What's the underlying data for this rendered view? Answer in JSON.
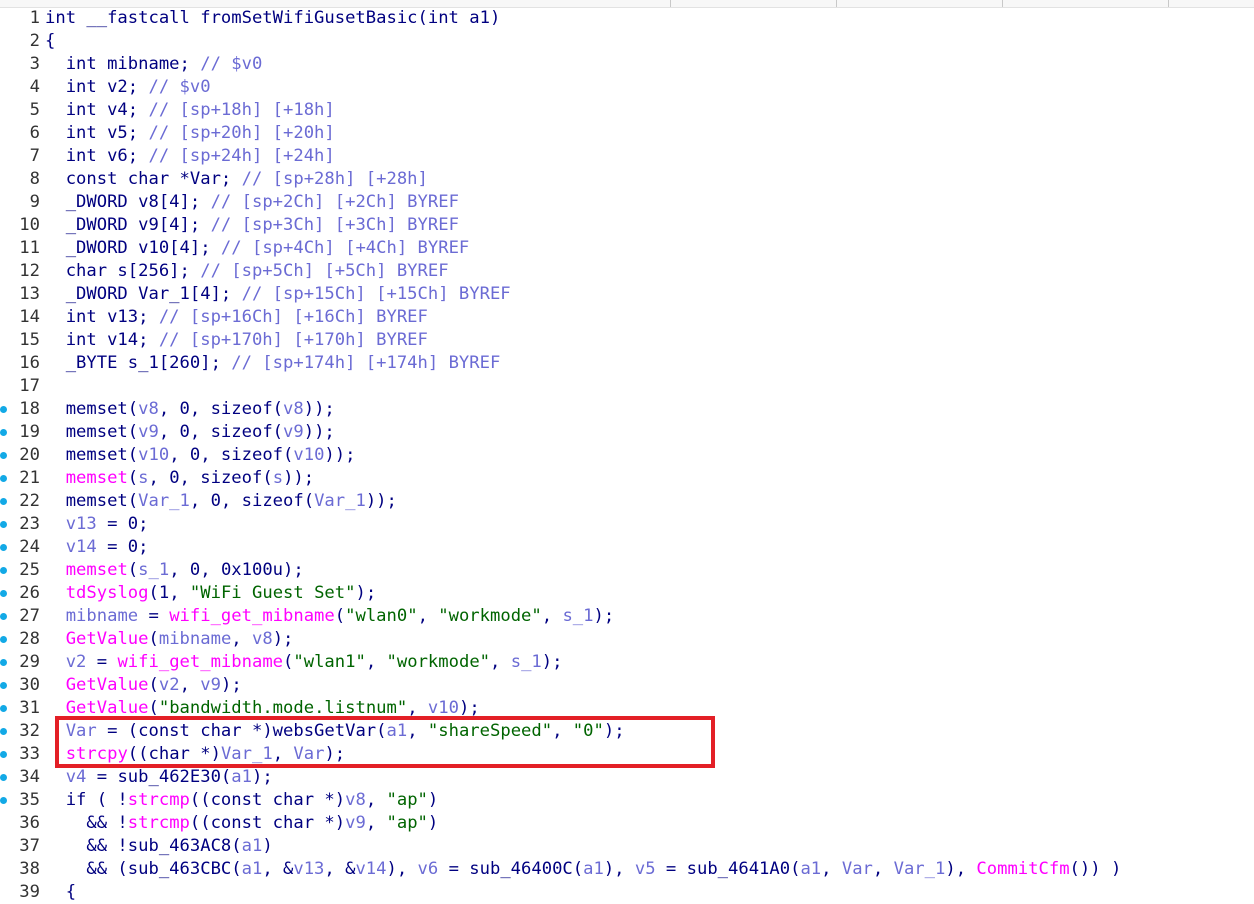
{
  "editor": {
    "function_signature": "int __fastcall fromSetWifiGusetBasic(int a1)",
    "lines": [
      {
        "n": "1",
        "dot": false,
        "tokens": [
          {
            "t": "int __fastcall fromSetWifiGusetBasic(int a1)",
            "c": "plain"
          }
        ]
      },
      {
        "n": "2",
        "dot": false,
        "tokens": [
          {
            "t": "{",
            "c": "plain"
          }
        ]
      },
      {
        "n": "3",
        "dot": false,
        "tokens": [
          {
            "t": "  int mibname; ",
            "c": "plain"
          },
          {
            "t": "// $v0",
            "c": "comment"
          }
        ]
      },
      {
        "n": "4",
        "dot": false,
        "tokens": [
          {
            "t": "  int v2; ",
            "c": "plain"
          },
          {
            "t": "// $v0",
            "c": "comment"
          }
        ]
      },
      {
        "n": "5",
        "dot": false,
        "tokens": [
          {
            "t": "  int v4; ",
            "c": "plain"
          },
          {
            "t": "// [sp+18h] [+18h]",
            "c": "comment"
          }
        ]
      },
      {
        "n": "6",
        "dot": false,
        "tokens": [
          {
            "t": "  int v5; ",
            "c": "plain"
          },
          {
            "t": "// [sp+20h] [+20h]",
            "c": "comment"
          }
        ]
      },
      {
        "n": "7",
        "dot": false,
        "tokens": [
          {
            "t": "  int v6; ",
            "c": "plain"
          },
          {
            "t": "// [sp+24h] [+24h]",
            "c": "comment"
          }
        ]
      },
      {
        "n": "8",
        "dot": false,
        "tokens": [
          {
            "t": "  const char *Var; ",
            "c": "plain"
          },
          {
            "t": "// [sp+28h] [+28h]",
            "c": "comment"
          }
        ]
      },
      {
        "n": "9",
        "dot": false,
        "tokens": [
          {
            "t": "  _DWORD v8[4]; ",
            "c": "plain"
          },
          {
            "t": "// [sp+2Ch] [+2Ch] BYREF",
            "c": "comment"
          }
        ]
      },
      {
        "n": "10",
        "dot": false,
        "tokens": [
          {
            "t": "  _DWORD v9[4]; ",
            "c": "plain"
          },
          {
            "t": "// [sp+3Ch] [+3Ch] BYREF",
            "c": "comment"
          }
        ]
      },
      {
        "n": "11",
        "dot": false,
        "tokens": [
          {
            "t": "  _DWORD v10[4]; ",
            "c": "plain"
          },
          {
            "t": "// [sp+4Ch] [+4Ch] BYREF",
            "c": "comment"
          }
        ]
      },
      {
        "n": "12",
        "dot": false,
        "tokens": [
          {
            "t": "  char s[256]; ",
            "c": "plain"
          },
          {
            "t": "// [sp+5Ch] [+5Ch] BYREF",
            "c": "comment"
          }
        ]
      },
      {
        "n": "13",
        "dot": false,
        "tokens": [
          {
            "t": "  _DWORD Var_1[4]; ",
            "c": "plain"
          },
          {
            "t": "// [sp+15Ch] [+15Ch] BYREF",
            "c": "comment"
          }
        ]
      },
      {
        "n": "14",
        "dot": false,
        "tokens": [
          {
            "t": "  int v13; ",
            "c": "plain"
          },
          {
            "t": "// [sp+16Ch] [+16Ch] BYREF",
            "c": "comment"
          }
        ]
      },
      {
        "n": "15",
        "dot": false,
        "tokens": [
          {
            "t": "  int v14; ",
            "c": "plain"
          },
          {
            "t": "// [sp+170h] [+170h] BYREF",
            "c": "comment"
          }
        ]
      },
      {
        "n": "16",
        "dot": false,
        "tokens": [
          {
            "t": "  _BYTE s_1[260]; ",
            "c": "plain"
          },
          {
            "t": "// [sp+174h] [+174h] BYREF",
            "c": "comment"
          }
        ]
      },
      {
        "n": "17",
        "dot": false,
        "tokens": [
          {
            "t": "",
            "c": "plain"
          }
        ]
      },
      {
        "n": "18",
        "dot": true,
        "tokens": [
          {
            "t": "  memset(",
            "c": "plain"
          },
          {
            "t": "v8",
            "c": "var"
          },
          {
            "t": ", 0, sizeof(",
            "c": "plain"
          },
          {
            "t": "v8",
            "c": "var"
          },
          {
            "t": "));",
            "c": "plain"
          }
        ]
      },
      {
        "n": "19",
        "dot": true,
        "tokens": [
          {
            "t": "  memset(",
            "c": "plain"
          },
          {
            "t": "v9",
            "c": "var"
          },
          {
            "t": ", 0, sizeof(",
            "c": "plain"
          },
          {
            "t": "v9",
            "c": "var"
          },
          {
            "t": "));",
            "c": "plain"
          }
        ]
      },
      {
        "n": "20",
        "dot": true,
        "tokens": [
          {
            "t": "  memset(",
            "c": "plain"
          },
          {
            "t": "v10",
            "c": "var"
          },
          {
            "t": ", 0, sizeof(",
            "c": "plain"
          },
          {
            "t": "v10",
            "c": "var"
          },
          {
            "t": "));",
            "c": "plain"
          }
        ]
      },
      {
        "n": "21",
        "dot": true,
        "tokens": [
          {
            "t": "  ",
            "c": "plain"
          },
          {
            "t": "memset",
            "c": "func"
          },
          {
            "t": "(",
            "c": "plain"
          },
          {
            "t": "s",
            "c": "var"
          },
          {
            "t": ", 0, sizeof(",
            "c": "plain"
          },
          {
            "t": "s",
            "c": "var"
          },
          {
            "t": "));",
            "c": "plain"
          }
        ]
      },
      {
        "n": "22",
        "dot": true,
        "tokens": [
          {
            "t": "  memset(",
            "c": "plain"
          },
          {
            "t": "Var_1",
            "c": "var"
          },
          {
            "t": ", 0, sizeof(",
            "c": "plain"
          },
          {
            "t": "Var_1",
            "c": "var"
          },
          {
            "t": "));",
            "c": "plain"
          }
        ]
      },
      {
        "n": "23",
        "dot": true,
        "tokens": [
          {
            "t": "  ",
            "c": "plain"
          },
          {
            "t": "v13",
            "c": "var"
          },
          {
            "t": " = 0;",
            "c": "plain"
          }
        ]
      },
      {
        "n": "24",
        "dot": true,
        "tokens": [
          {
            "t": "  ",
            "c": "plain"
          },
          {
            "t": "v14",
            "c": "var"
          },
          {
            "t": " = 0;",
            "c": "plain"
          }
        ]
      },
      {
        "n": "25",
        "dot": true,
        "tokens": [
          {
            "t": "  ",
            "c": "plain"
          },
          {
            "t": "memset",
            "c": "func"
          },
          {
            "t": "(",
            "c": "plain"
          },
          {
            "t": "s_1",
            "c": "var"
          },
          {
            "t": ", 0, 0x100u);",
            "c": "plain"
          }
        ]
      },
      {
        "n": "26",
        "dot": true,
        "tokens": [
          {
            "t": "  ",
            "c": "plain"
          },
          {
            "t": "tdSyslog",
            "c": "func"
          },
          {
            "t": "(1, ",
            "c": "plain"
          },
          {
            "t": "\"WiFi Guest Set\"",
            "c": "string"
          },
          {
            "t": ");",
            "c": "plain"
          }
        ]
      },
      {
        "n": "27",
        "dot": true,
        "tokens": [
          {
            "t": "  ",
            "c": "plain"
          },
          {
            "t": "mibname",
            "c": "var"
          },
          {
            "t": " = ",
            "c": "plain"
          },
          {
            "t": "wifi_get_mibname",
            "c": "func"
          },
          {
            "t": "(",
            "c": "plain"
          },
          {
            "t": "\"wlan0\"",
            "c": "string"
          },
          {
            "t": ", ",
            "c": "plain"
          },
          {
            "t": "\"workmode\"",
            "c": "string"
          },
          {
            "t": ", ",
            "c": "plain"
          },
          {
            "t": "s_1",
            "c": "var"
          },
          {
            "t": ");",
            "c": "plain"
          }
        ]
      },
      {
        "n": "28",
        "dot": true,
        "tokens": [
          {
            "t": "  ",
            "c": "plain"
          },
          {
            "t": "GetValue",
            "c": "func"
          },
          {
            "t": "(",
            "c": "plain"
          },
          {
            "t": "mibname",
            "c": "var"
          },
          {
            "t": ", ",
            "c": "plain"
          },
          {
            "t": "v8",
            "c": "var"
          },
          {
            "t": ");",
            "c": "plain"
          }
        ]
      },
      {
        "n": "29",
        "dot": true,
        "tokens": [
          {
            "t": "  ",
            "c": "plain"
          },
          {
            "t": "v2",
            "c": "var"
          },
          {
            "t": " = ",
            "c": "plain"
          },
          {
            "t": "wifi_get_mibname",
            "c": "func"
          },
          {
            "t": "(",
            "c": "plain"
          },
          {
            "t": "\"wlan1\"",
            "c": "string"
          },
          {
            "t": ", ",
            "c": "plain"
          },
          {
            "t": "\"workmode\"",
            "c": "string"
          },
          {
            "t": ", ",
            "c": "plain"
          },
          {
            "t": "s_1",
            "c": "var"
          },
          {
            "t": ");",
            "c": "plain"
          }
        ]
      },
      {
        "n": "30",
        "dot": true,
        "tokens": [
          {
            "t": "  ",
            "c": "plain"
          },
          {
            "t": "GetValue",
            "c": "func"
          },
          {
            "t": "(",
            "c": "plain"
          },
          {
            "t": "v2",
            "c": "var"
          },
          {
            "t": ", ",
            "c": "plain"
          },
          {
            "t": "v9",
            "c": "var"
          },
          {
            "t": ");",
            "c": "plain"
          }
        ]
      },
      {
        "n": "31",
        "dot": true,
        "tokens": [
          {
            "t": "  ",
            "c": "plain"
          },
          {
            "t": "GetValue",
            "c": "func"
          },
          {
            "t": "(",
            "c": "plain"
          },
          {
            "t": "\"bandwidth.mode.listnum\"",
            "c": "string"
          },
          {
            "t": ", ",
            "c": "plain"
          },
          {
            "t": "v10",
            "c": "var"
          },
          {
            "t": ");",
            "c": "plain"
          }
        ]
      },
      {
        "n": "32",
        "dot": true,
        "tokens": [
          {
            "t": "  ",
            "c": "plain"
          },
          {
            "t": "Var",
            "c": "var"
          },
          {
            "t": " = (const char *)websGetVar(",
            "c": "plain"
          },
          {
            "t": "a1",
            "c": "var"
          },
          {
            "t": ", ",
            "c": "plain"
          },
          {
            "t": "\"shareSpeed\"",
            "c": "string"
          },
          {
            "t": ", ",
            "c": "plain"
          },
          {
            "t": "\"0\"",
            "c": "string"
          },
          {
            "t": ");",
            "c": "plain"
          }
        ]
      },
      {
        "n": "33",
        "dot": true,
        "tokens": [
          {
            "t": "  ",
            "c": "plain"
          },
          {
            "t": "strcpy",
            "c": "func"
          },
          {
            "t": "((char *)",
            "c": "plain"
          },
          {
            "t": "Var_1",
            "c": "var"
          },
          {
            "t": ", ",
            "c": "plain"
          },
          {
            "t": "Var",
            "c": "var"
          },
          {
            "t": ");",
            "c": "plain"
          }
        ]
      },
      {
        "n": "34",
        "dot": true,
        "tokens": [
          {
            "t": "  ",
            "c": "plain"
          },
          {
            "t": "v4",
            "c": "var"
          },
          {
            "t": " = sub_462E30(",
            "c": "plain"
          },
          {
            "t": "a1",
            "c": "var"
          },
          {
            "t": ");",
            "c": "plain"
          }
        ]
      },
      {
        "n": "35",
        "dot": true,
        "tokens": [
          {
            "t": "  if ( !",
            "c": "plain"
          },
          {
            "t": "strcmp",
            "c": "func"
          },
          {
            "t": "((const char *)",
            "c": "plain"
          },
          {
            "t": "v8",
            "c": "var"
          },
          {
            "t": ", ",
            "c": "plain"
          },
          {
            "t": "\"ap\"",
            "c": "string"
          },
          {
            "t": ")",
            "c": "plain"
          }
        ]
      },
      {
        "n": "36",
        "dot": false,
        "tokens": [
          {
            "t": "    && !",
            "c": "plain"
          },
          {
            "t": "strcmp",
            "c": "func"
          },
          {
            "t": "((const char *)",
            "c": "plain"
          },
          {
            "t": "v9",
            "c": "var"
          },
          {
            "t": ", ",
            "c": "plain"
          },
          {
            "t": "\"ap\"",
            "c": "string"
          },
          {
            "t": ")",
            "c": "plain"
          }
        ]
      },
      {
        "n": "37",
        "dot": false,
        "tokens": [
          {
            "t": "    && !sub_463AC8(",
            "c": "plain"
          },
          {
            "t": "a1",
            "c": "var"
          },
          {
            "t": ")",
            "c": "plain"
          }
        ]
      },
      {
        "n": "38",
        "dot": false,
        "tokens": [
          {
            "t": "    && (sub_463CBC(",
            "c": "plain"
          },
          {
            "t": "a1",
            "c": "var"
          },
          {
            "t": ", &",
            "c": "plain"
          },
          {
            "t": "v13",
            "c": "var"
          },
          {
            "t": ", &",
            "c": "plain"
          },
          {
            "t": "v14",
            "c": "var"
          },
          {
            "t": "), ",
            "c": "plain"
          },
          {
            "t": "v6",
            "c": "var"
          },
          {
            "t": " = sub_46400C(",
            "c": "plain"
          },
          {
            "t": "a1",
            "c": "var"
          },
          {
            "t": "), ",
            "c": "plain"
          },
          {
            "t": "v5",
            "c": "var"
          },
          {
            "t": " = sub_4641A0(",
            "c": "plain"
          },
          {
            "t": "a1",
            "c": "var"
          },
          {
            "t": ", ",
            "c": "plain"
          },
          {
            "t": "Var",
            "c": "var"
          },
          {
            "t": ", ",
            "c": "plain"
          },
          {
            "t": "Var_1",
            "c": "var"
          },
          {
            "t": "), ",
            "c": "plain"
          },
          {
            "t": "CommitCfm",
            "c": "func"
          },
          {
            "t": "()) )",
            "c": "plain"
          }
        ]
      },
      {
        "n": "39",
        "dot": false,
        "tokens": [
          {
            "t": "  {",
            "c": "plain"
          }
        ]
      }
    ]
  },
  "highlight": {
    "color": "#e31f26",
    "covers_lines": [
      "32",
      "33"
    ]
  },
  "colors": {
    "plain": "#000080",
    "comment": "#6b6bd4",
    "string": "#006400",
    "function": "#ff00ff",
    "breakpoint_dot": "#12a9e6"
  }
}
